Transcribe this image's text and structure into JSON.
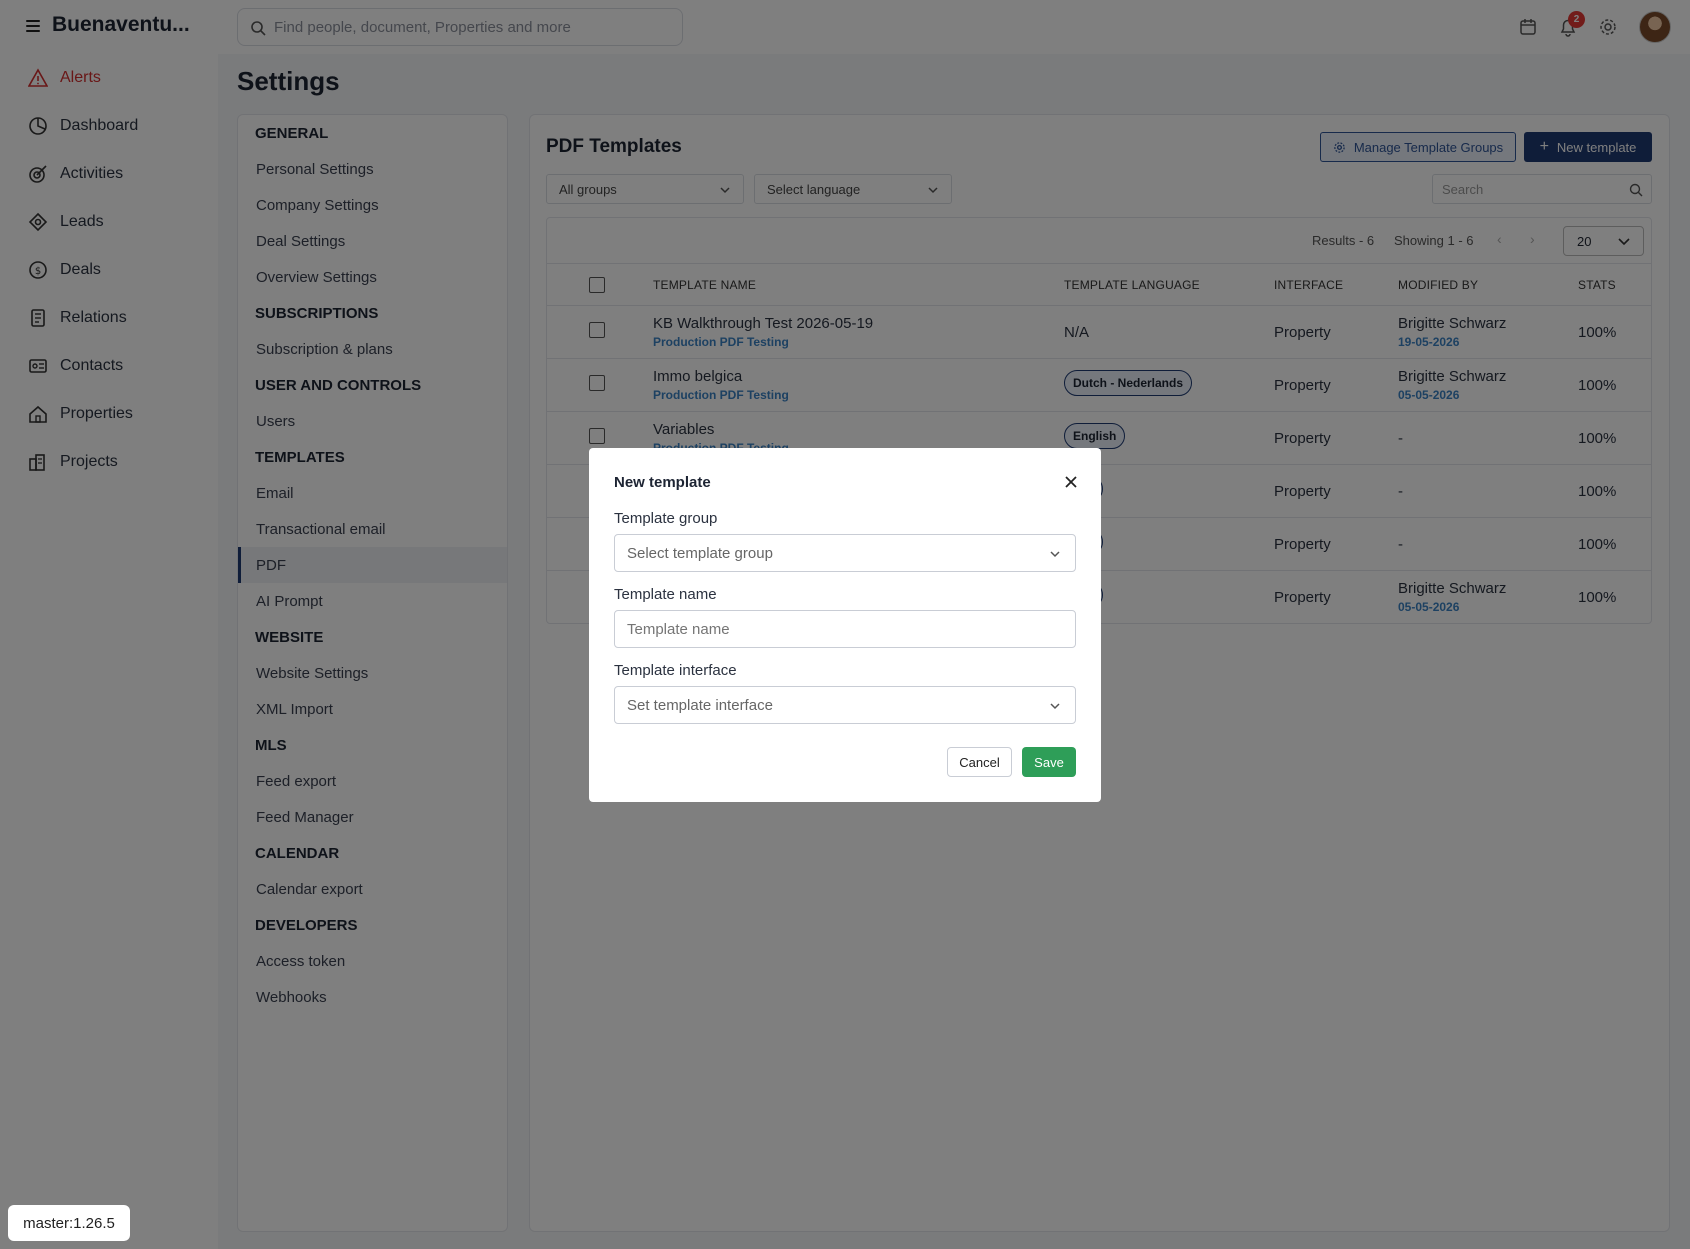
{
  "app": {
    "brand": "Buenaventu...",
    "search_placeholder": "Find people, document, Properties and more",
    "notification_count": "2",
    "version": "master:1.26.5"
  },
  "nav": [
    {
      "label": "Alerts",
      "icon": "alert-icon"
    },
    {
      "label": "Dashboard",
      "icon": "dashboard-icon"
    },
    {
      "label": "Activities",
      "icon": "activities-icon"
    },
    {
      "label": "Leads",
      "icon": "leads-icon"
    },
    {
      "label": "Deals",
      "icon": "deals-icon"
    },
    {
      "label": "Relations",
      "icon": "relations-icon"
    },
    {
      "label": "Contacts",
      "icon": "contacts-icon"
    },
    {
      "label": "Properties",
      "icon": "properties-icon"
    },
    {
      "label": "Projects",
      "icon": "projects-icon"
    }
  ],
  "page_title": "Settings",
  "settings": {
    "general_title": "GENERAL",
    "personal": "Personal Settings",
    "company": "Company Settings",
    "deal": "Deal Settings",
    "overview": "Overview Settings",
    "subs_title": "SUBSCRIPTIONS",
    "subs_plans": "Subscription & plans",
    "user_title": "USER AND CONTROLS",
    "users": "Users",
    "templates_title": "TEMPLATES",
    "email": "Email",
    "transactional": "Transactional email",
    "pdf": "PDF",
    "ai_prompt": "AI Prompt",
    "website_title": "WEBSITE",
    "website_settings": "Website Settings",
    "xml_import": "XML Import",
    "mls_title": "MLS",
    "feed_export": "Feed export",
    "feed_manager": "Feed Manager",
    "calendar_title": "CALENDAR",
    "calendar_export": "Calendar export",
    "dev_title": "DEVELOPERS",
    "access_token": "Access token",
    "webhooks": "Webhooks"
  },
  "content": {
    "title": "PDF Templates",
    "manage_groups": "Manage Template Groups",
    "new_template": "New template",
    "groups_select": "All groups",
    "language_select": "Select language",
    "search_placeholder": "Search",
    "results": "Results - 6",
    "showing": "Showing 1 - 6",
    "per_page": "20",
    "headers": {
      "name": "TEMPLATE NAME",
      "language": "TEMPLATE LANGUAGE",
      "interface": "INTERFACE",
      "modified": "MODIFIED BY",
      "stats": "STATS"
    },
    "rows": [
      {
        "name": "KB Walkthrough Test 2026-05-19",
        "group": "Production PDF Testing",
        "language": "N/A",
        "interface": "Property",
        "modified_by": "Brigitte Schwarz",
        "modified_date": "19-05-2026",
        "stats": "100%"
      },
      {
        "name": "Immo belgica",
        "group": "Production PDF Testing",
        "language": "Dutch - Nederlands",
        "interface": "Property",
        "modified_by": "Brigitte Schwarz",
        "modified_date": "05-05-2026",
        "stats": "100%"
      },
      {
        "name": "Variables",
        "group": "Production PDF Testing",
        "language": "English",
        "interface": "Property",
        "modified_by": "-",
        "modified_date": "",
        "stats": "100%"
      },
      {
        "name": "",
        "group": "",
        "language": "lish",
        "interface": "Property",
        "modified_by": "-",
        "modified_date": "",
        "stats": "100%"
      },
      {
        "name": "",
        "group": "",
        "language": "lish",
        "interface": "Property",
        "modified_by": "-",
        "modified_date": "",
        "stats": "100%"
      },
      {
        "name": "",
        "group": "",
        "language": "lish",
        "interface": "Property",
        "modified_by": "Brigitte Schwarz",
        "modified_date": "05-05-2026",
        "stats": "100%"
      }
    ]
  },
  "modal": {
    "title": "New template",
    "group_label": "Template group",
    "group_placeholder": "Select template group",
    "name_label": "Template name",
    "name_placeholder": "Template name",
    "interface_label": "Template interface",
    "interface_placeholder": "Set template interface",
    "cancel": "Cancel",
    "save": "Save"
  },
  "colors": {
    "primary": "#1f3b73",
    "alert": "#d32f2f",
    "save": "#2e9e58",
    "link": "#3b82c4"
  }
}
